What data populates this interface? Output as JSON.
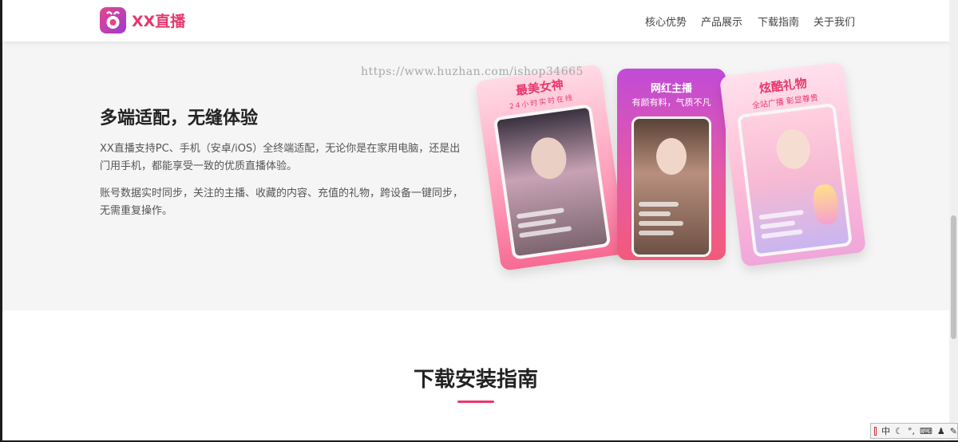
{
  "header": {
    "brand": "XX直播",
    "nav": [
      "核心优势",
      "产品展示",
      "下载指南",
      "关于我们"
    ]
  },
  "watermark": "https://www.huzhan.com/ishop34665",
  "feature": {
    "title": "多端适配，无缝体验",
    "paragraphs": [
      "XX直播支持PC、手机（安卓/iOS）全终端适配，无论你是在家用电脑，还是出门用手机，都能享受一致的优质直播体验。",
      "账号数据实时同步，关注的主播、收藏的内容、充值的礼物，跨设备一键同步，无需重复操作。"
    ]
  },
  "cards": [
    {
      "title": "最美女神",
      "subtitle": "24小时实时在线"
    },
    {
      "title": "网红主播",
      "subtitle": "有颜有料，气质不凡"
    },
    {
      "title": "炫酷礼物",
      "subtitle": "全站广播 彰显尊贵"
    }
  ],
  "download": {
    "title": "下载安装指南"
  },
  "ime": {
    "mode": "中"
  },
  "colors": {
    "brand": "#e8386d",
    "feature_bg": "#f5f5f5"
  }
}
